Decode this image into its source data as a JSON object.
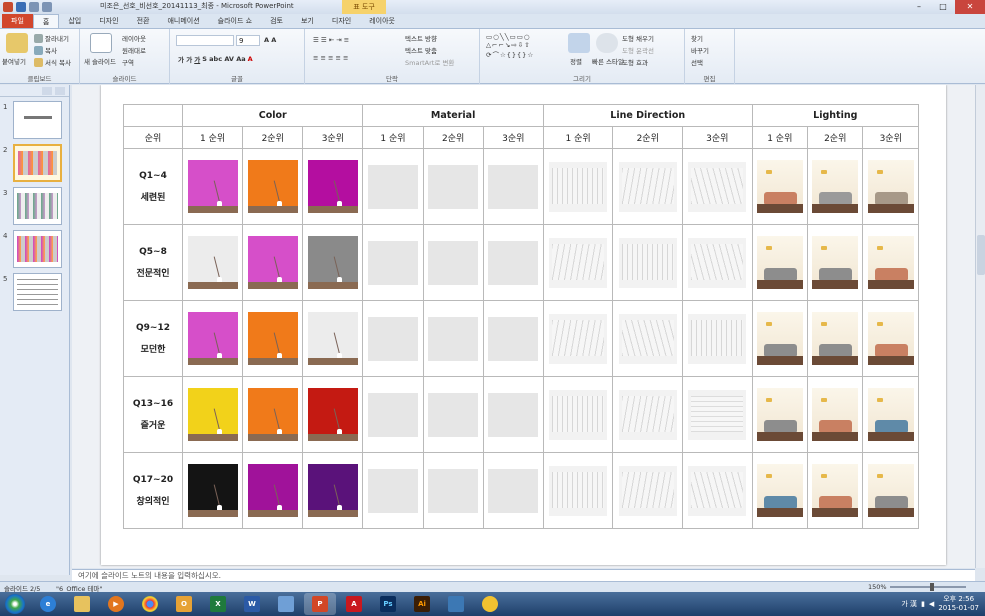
{
  "titlebar": {
    "title": "미조은_선호_비선호_20141113_최종 - Microsoft PowerPoint",
    "context_tab": "표 도구"
  },
  "tabs": [
    "파일",
    "홈",
    "삽입",
    "디자인",
    "전환",
    "애니메이션",
    "슬라이드 쇼",
    "검토",
    "보기",
    "디자인",
    "레이아웃"
  ],
  "ribbon": {
    "clipboard": {
      "paste": "붙여넣기",
      "cut": "잘라내기",
      "copy": "복사",
      "format_painter": "서식 복사",
      "label": "클립보드"
    },
    "slides": {
      "new_slide": "새 슬라이드",
      "layout": "레이아웃",
      "reset": "원래대로",
      "section": "구역",
      "label": "슬라이드"
    },
    "font": {
      "font_size": "9",
      "label": "글꼴"
    },
    "paragraph": {
      "text_direction": "텍스트 방향",
      "align_text": "텍스트 맞춤",
      "smartart": "SmartArt로 변환",
      "label": "단락"
    },
    "drawing": {
      "arrange": "정렬",
      "quick_styles": "빠른 스타일",
      "shape_fill": "도형 채우기",
      "shape_outline": "도형 윤곽선",
      "shape_effects": "도형 효과",
      "label": "그리기"
    },
    "editing": {
      "find": "찾기",
      "replace": "바꾸기",
      "select": "선택",
      "label": "편집"
    }
  },
  "slides_pane": {
    "slide_numbers": [
      "1",
      "2",
      "3",
      "4",
      "5"
    ],
    "selected": "2"
  },
  "table": {
    "groups": [
      "Color",
      "Material",
      "Line Direction",
      "Lighting"
    ],
    "rank_header": "순위",
    "ranks": [
      "1 순위",
      "2순위",
      "3순위",
      "1 순위",
      "2순위",
      "3순위",
      "1 순위",
      "2순위",
      "3순위",
      "1 순위",
      "2순위",
      "3순위"
    ],
    "rows": [
      {
        "q": "Q1~4",
        "label": "세련된",
        "colors": [
          "#d64fc9",
          "#f07a1a",
          "#b40ea0"
        ],
        "materials": [
          "swirl",
          "concrete",
          "glass"
        ],
        "lines": [
          "v1",
          "v2",
          "v3"
        ],
        "lights": [
          "#c98062",
          "#9a9a9a",
          "#a79988"
        ]
      },
      {
        "q": "Q5~8",
        "label": "전문적인",
        "colors": [
          "#ececec",
          "#d64fc9",
          "#8a8a8a"
        ],
        "materials": [
          "concrete",
          "swirl",
          "glass"
        ],
        "lines": [
          "v2",
          "v1",
          "v3"
        ],
        "lights": [
          "#8d8d8d",
          "#8d8d8d",
          "#c98062"
        ]
      },
      {
        "q": "Q9~12",
        "label": "모던한",
        "colors": [
          "#d64fc9",
          "#f07a1a",
          "#ececec"
        ],
        "materials": [
          "concrete",
          "swirl",
          "glass"
        ],
        "lines": [
          "v2",
          "v3",
          "v1"
        ],
        "lights": [
          "#8d8d8d",
          "#8d8d8d",
          "#c98062"
        ]
      },
      {
        "q": "Q13~16",
        "label": "즐거운",
        "colors": [
          "#f2d21a",
          "#f07a1a",
          "#c41a12"
        ],
        "materials": [
          "concrete",
          "swirl",
          "glass"
        ],
        "lines": [
          "v1",
          "v2",
          "v4"
        ],
        "lights": [
          "#8d8d8d",
          "#c98062",
          "#5f8aa8"
        ]
      },
      {
        "q": "Q17~20",
        "label": "창의적인",
        "colors": [
          "#141414",
          "#a0129a",
          "#5a127a"
        ],
        "materials": [
          "concrete",
          "glass",
          "wood"
        ],
        "lines": [
          "v1",
          "v2",
          "v3"
        ],
        "lights": [
          "#5f8aa8",
          "#c98062",
          "#8d8d8d"
        ]
      }
    ]
  },
  "notes": "여기에 슬라이드 노트의 내용을 입력하십시오.",
  "status": {
    "slide_counter": "슬라이드 2/5",
    "theme": "\"6_Office 테마\"",
    "zoom": "150%"
  },
  "taskbar": {
    "ime": "가 漢",
    "ampm": "오후 2:56",
    "date": "2015-01-07"
  }
}
